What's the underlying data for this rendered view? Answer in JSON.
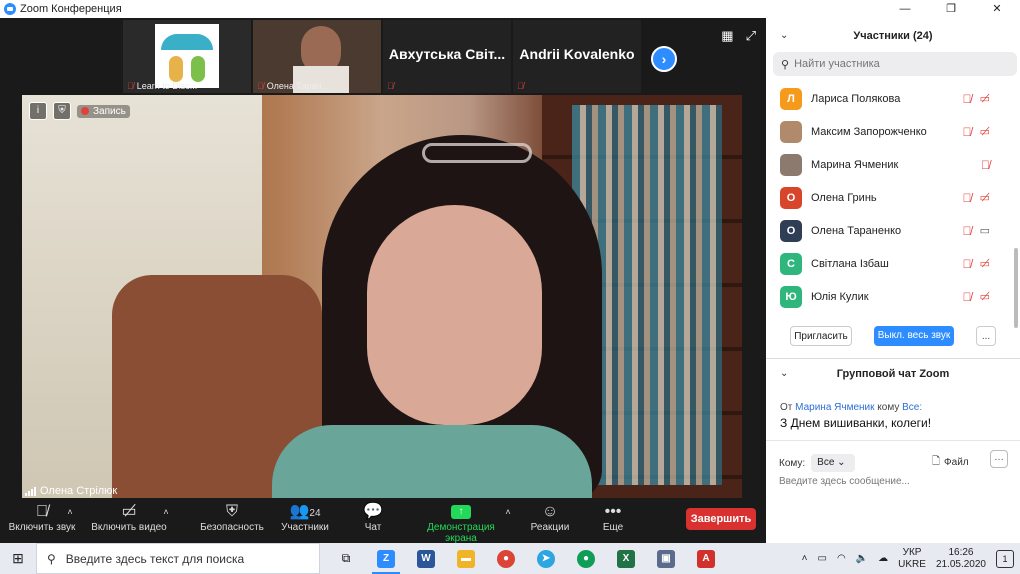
{
  "window": {
    "title": "Zoom Конференция",
    "controls": [
      "—",
      "❐",
      "✕"
    ]
  },
  "strip": {
    "thumbs": [
      {
        "name": "Learn to Disc..."
      },
      {
        "name": "Олена Таран..."
      },
      {
        "name": "Авхутська Світ..."
      },
      {
        "name": "Andrii Kovalenko"
      }
    ],
    "next_label": "›"
  },
  "video": {
    "recording_label": "Запись",
    "speaker_name": "Олена Стрілюк"
  },
  "toolbar": {
    "unmute": "Включить звук",
    "start_video": "Включить видео",
    "security": "Безопасность",
    "participants": "Участники",
    "participants_count": "24",
    "chat": "Чат",
    "share": "Демонстрация экрана",
    "reactions": "Реакции",
    "more": "Еще",
    "end": "Завершить"
  },
  "panel": {
    "title": "Участники (24)",
    "search_placeholder": "Найти участника",
    "participants": [
      {
        "initial": "Л",
        "name": "Лариса Полякова",
        "color": "#f59a1b",
        "video": "off"
      },
      {
        "initial": "",
        "name": "Максим Запорожченко",
        "color": "#b08a6a",
        "video": "off"
      },
      {
        "initial": "",
        "name": "Марина Ячменик",
        "color": "#8c7a6f",
        "video": "none"
      },
      {
        "initial": "О",
        "name": "Олена Гринь",
        "color": "#d8452b",
        "video": "off"
      },
      {
        "initial": "О",
        "name": "Олена Тараненко",
        "color": "#2f3e55",
        "video": "on"
      },
      {
        "initial": "С",
        "name": "Світлана Ізбаш",
        "color": "#2eb67d",
        "video": "off"
      },
      {
        "initial": "Ю",
        "name": "Юлія Кулик",
        "color": "#2eb67d",
        "video": "off"
      }
    ],
    "invite": "Пригласить",
    "mute_all": "Выкл. весь звук",
    "more": "...",
    "chat_title": "Групповой чат Zoom",
    "chat_from_prefix": "От",
    "chat_from_name": "Марина Ячменик",
    "chat_to_prefix": "кому",
    "chat_to_name": "Все:",
    "chat_message": "З Днем вишиванки, колеги!",
    "to_label": "Кому:",
    "to_value": "Все",
    "file_label": "Файл",
    "message_placeholder": "Введите здесь сообщение..."
  },
  "taskbar": {
    "search_placeholder": "Введите здесь текст для поиска",
    "lang": "УКР",
    "lang2": "UKRE",
    "time": "16:26",
    "date": "21.05.2020",
    "notifications": "1"
  }
}
